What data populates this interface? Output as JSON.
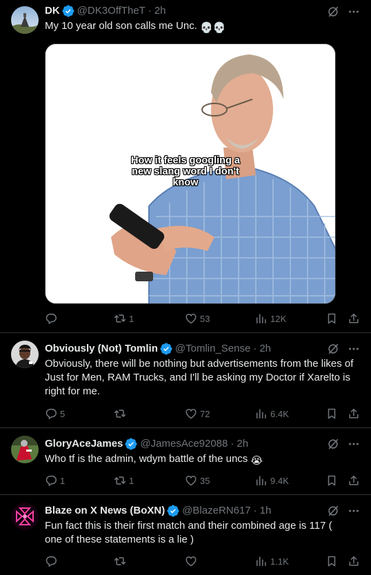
{
  "posts": [
    {
      "name": "DK",
      "handle": "@DK3OffTheT",
      "dot": "·",
      "time": "2h",
      "text": "My 10 year old son calls me Unc.",
      "text_emoji": "💀💀",
      "media_caption": "How it feels googling a new slang word I don't know",
      "reply_count": "",
      "repost_count": "1",
      "like_count": "53",
      "view_count": "12K"
    },
    {
      "name": "Obviously (Not) Tomlin",
      "handle": "@Tomlin_Sense",
      "dot": "·",
      "time": "2h",
      "text": "Obviously, there will be nothing but advertisements from the likes of Just for Men, RAM Trucks, and I'll be asking my Doctor if Xarelto is right for me.",
      "reply_count": "5",
      "repost_count": "",
      "like_count": "72",
      "view_count": "6.4K"
    },
    {
      "name": "GloryAceJames",
      "handle": "@JamesAce92088",
      "dot": "·",
      "time": "2h",
      "text": "Who tf is the admin, wdym battle of the uncs",
      "text_emoji": "😭",
      "reply_count": "1",
      "repost_count": "1",
      "like_count": "35",
      "view_count": "9.4K"
    },
    {
      "name": "Blaze on X News (BoXN)",
      "handle": "@BlazeRN617",
      "dot": "·",
      "time": "1h",
      "text": "Fun fact this is their first match and their combined age is 117 ( one of these statements is a lie )",
      "reply_count": "",
      "repost_count": "",
      "like_count": "",
      "view_count": "1.1K"
    }
  ],
  "colors": {
    "background": "#000000",
    "text": "#e7e9ea",
    "muted": "#71767b",
    "verified": "#1d9bf0",
    "divider": "#2f3336"
  },
  "icons": [
    "verified-badge-icon",
    "grok-icon",
    "more-icon",
    "reply-icon",
    "repost-icon",
    "like-icon",
    "views-icon",
    "bookmark-icon",
    "share-icon"
  ]
}
